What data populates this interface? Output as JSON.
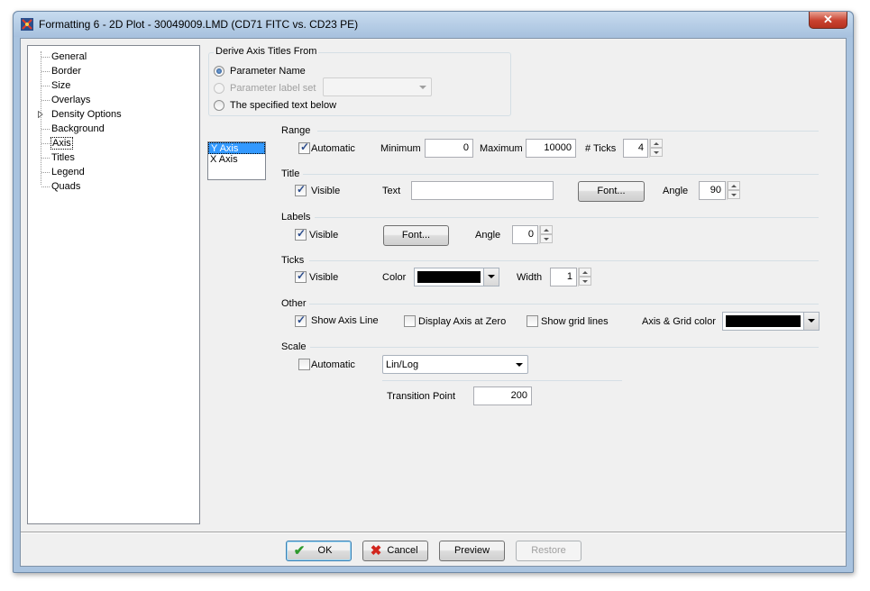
{
  "window": {
    "title": "Formatting 6 - 2D Plot - 30049009.LMD (CD71 FITC vs. CD23 PE)",
    "close_label": "✕",
    "titlebar_color": "#a9c3df"
  },
  "tree": {
    "items": [
      {
        "label": "General"
      },
      {
        "label": "Border"
      },
      {
        "label": "Size"
      },
      {
        "label": "Overlays"
      },
      {
        "label": "Density Options"
      },
      {
        "label": "Background"
      },
      {
        "label": "Axis"
      },
      {
        "label": "Titles"
      },
      {
        "label": "Legend"
      },
      {
        "label": "Quads"
      }
    ],
    "selected": "Axis"
  },
  "derive": {
    "group_title": "Derive Axis Titles From",
    "options": [
      {
        "label": "Parameter Name",
        "checked": true,
        "disabled": false
      },
      {
        "label": "Parameter label set",
        "checked": false,
        "disabled": true
      },
      {
        "label": "The specified text below",
        "checked": false,
        "disabled": false
      }
    ],
    "label_set_value": ""
  },
  "axis_list": {
    "items": [
      "Y Axis",
      "X Axis"
    ],
    "selected": "Y Axis"
  },
  "range": {
    "title": "Range",
    "automatic_label": "Automatic",
    "automatic_checked": true,
    "minimum_label": "Minimum",
    "minimum_value": "0",
    "maximum_label": "Maximum",
    "maximum_value": "10000",
    "ticks_label": "# Ticks",
    "ticks_value": "4"
  },
  "title_section": {
    "title": "Title",
    "visible_label": "Visible",
    "visible_checked": true,
    "text_label": "Text",
    "text_value": "",
    "font_button": "Font...",
    "angle_label": "Angle",
    "angle_value": "90"
  },
  "labels": {
    "title": "Labels",
    "visible_label": "Visible",
    "visible_checked": true,
    "font_button": "Font...",
    "angle_label": "Angle",
    "angle_value": "0"
  },
  "ticks": {
    "title": "Ticks",
    "visible_label": "Visible",
    "visible_checked": true,
    "color_label": "Color",
    "color_value": "#000000",
    "width_label": "Width",
    "width_value": "1"
  },
  "other": {
    "title": "Other",
    "show_axis_line_label": "Show Axis Line",
    "show_axis_line_checked": true,
    "display_axis_zero_label": "Display Axis at Zero",
    "display_axis_zero_checked": false,
    "show_grid_label": "Show grid lines",
    "show_grid_checked": false,
    "axis_grid_color_label": "Axis & Grid color",
    "axis_grid_color_value": "#000000"
  },
  "scale": {
    "title": "Scale",
    "automatic_label": "Automatic",
    "automatic_checked": false,
    "scale_type": "Lin/Log",
    "transition_label": "Transition Point",
    "transition_value": "200"
  },
  "buttons": {
    "ok": "OK",
    "cancel": "Cancel",
    "preview": "Preview",
    "restore": "Restore"
  }
}
